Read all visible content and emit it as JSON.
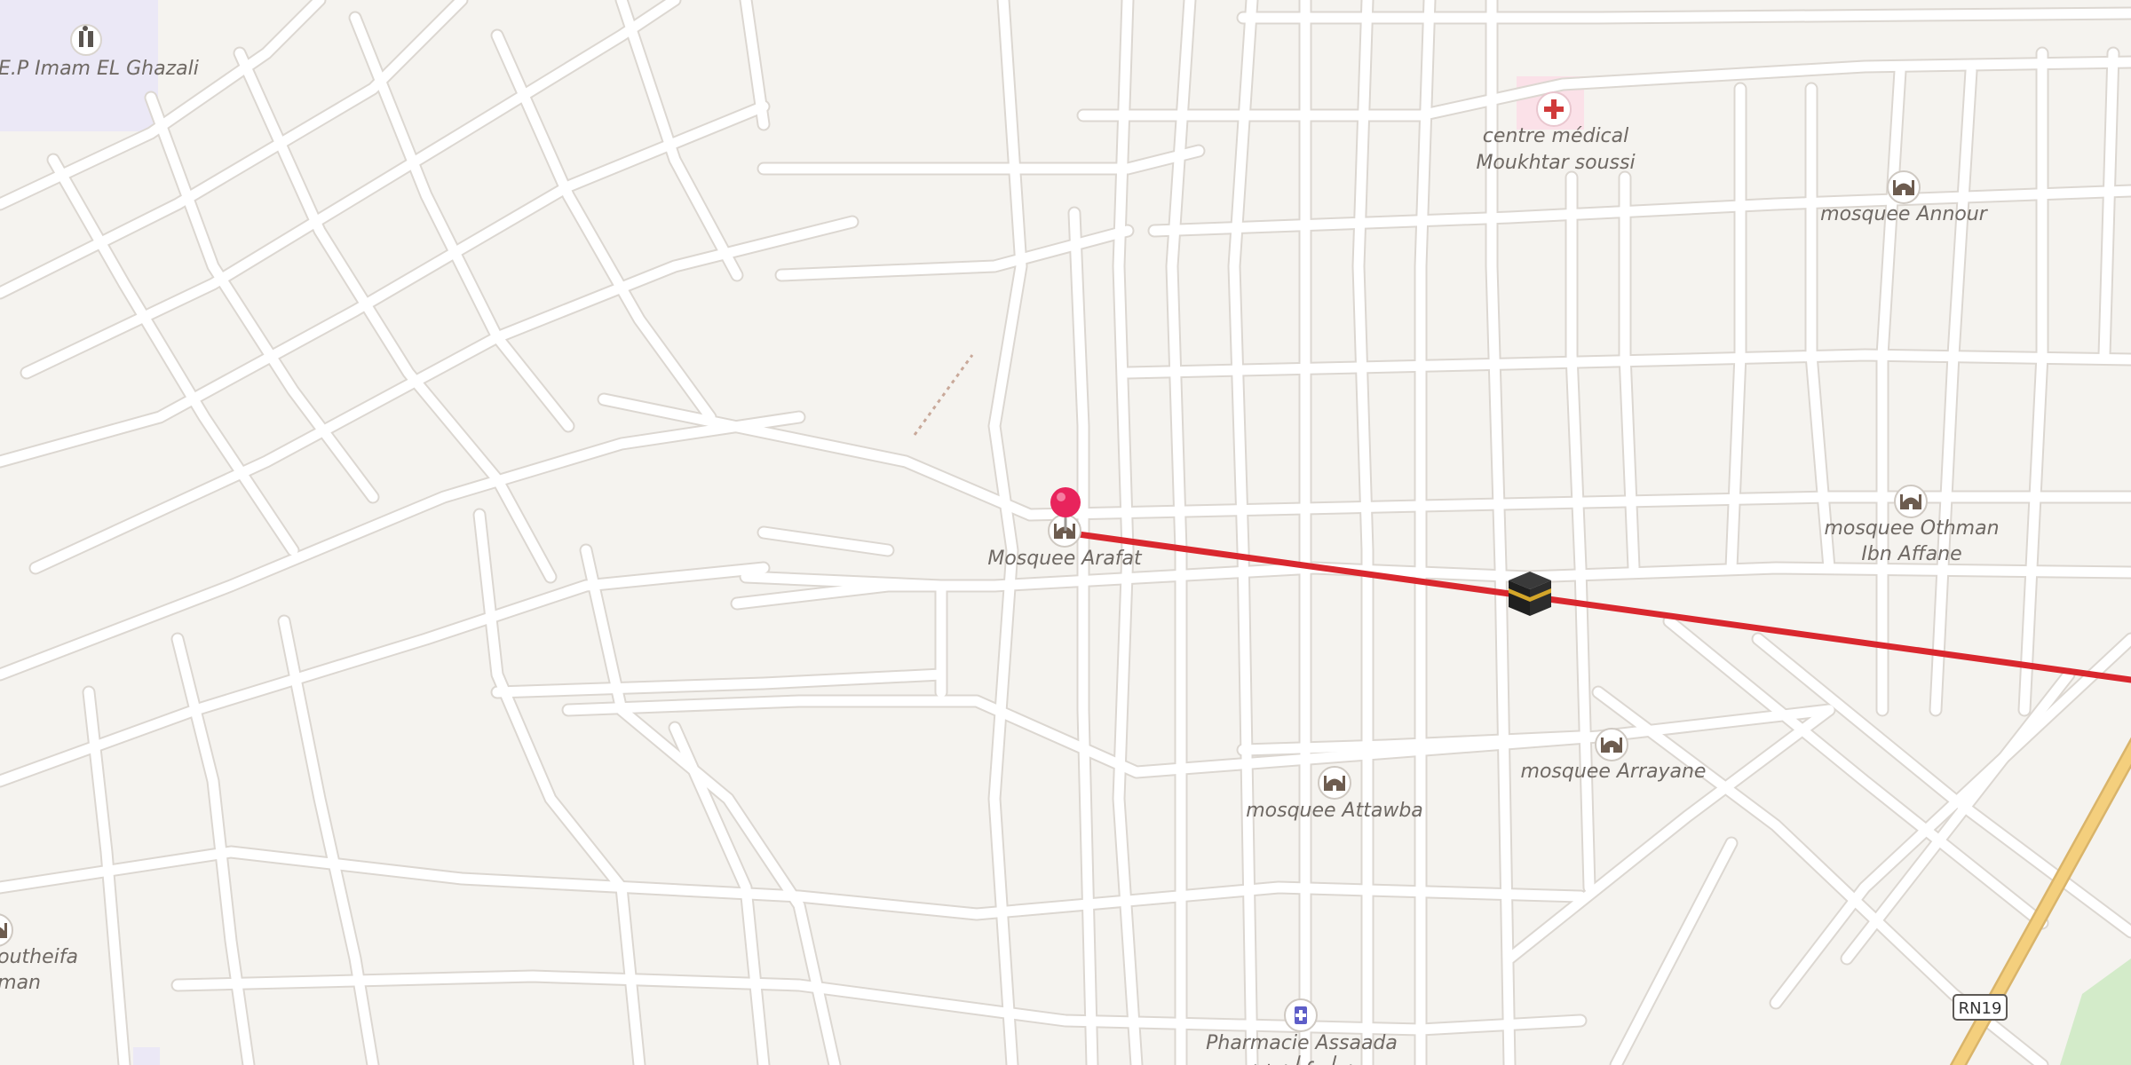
{
  "map": {
    "background_color": "#f5f3ef",
    "route_color": "#d9272e",
    "trunk_road_color": "#f4cf7d",
    "pois": [
      {
        "name": "E.P Imam EL Ghazali",
        "icon": "school-icon"
      },
      {
        "name_line1": "centre médical",
        "name_line2": "Moukhtar soussi",
        "icon": "hospital-cross-icon"
      },
      {
        "name": "mosquee Annour",
        "icon": "mosque-icon"
      },
      {
        "name": "Mosquee Arafat",
        "icon": "mosque-icon"
      },
      {
        "name_line1": "mosquee Othman",
        "name_line2": "Ibn Affane",
        "icon": "mosque-icon"
      },
      {
        "name": "mosquee Arrayane",
        "icon": "mosque-icon"
      },
      {
        "name": "mosquee Attawba",
        "icon": "mosque-icon"
      },
      {
        "name": "Pharmacie Assaada",
        "icon": "pharmacy-icon"
      },
      {
        "name_line1": "Houtheifa",
        "name_line2": "man",
        "icon": "mosque-icon"
      }
    ],
    "road_shield": "RN19",
    "markers": {
      "start_pin": "location-pin-icon",
      "destination": "kaaba-icon"
    }
  }
}
